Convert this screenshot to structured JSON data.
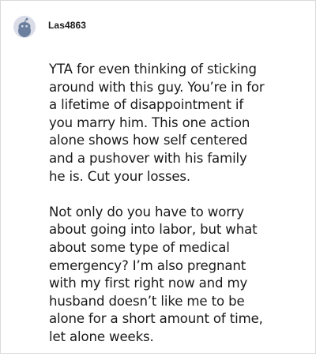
{
  "comment": {
    "username": "Las4863",
    "avatar_icon": "reddit-snoo-icon",
    "paragraphs": [
      {
        "lines": [
          "YTA for even thinking of sticking",
          "around with this guy. You’re in for",
          "a lifetime of disappointment if",
          "you marry him. This one action",
          "alone shows how self centered",
          "and a pushover with his family",
          "he is. Cut your losses."
        ]
      },
      {
        "lines": [
          "Not only do you have to worry",
          "about going into labor, but what",
          "about some type of medical",
          "emergency? I’m also pregnant",
          "with my first right now and my",
          "husband doesn’t like me to be",
          "alone for a short amount of time,",
          "let alone weeks."
        ]
      }
    ]
  }
}
